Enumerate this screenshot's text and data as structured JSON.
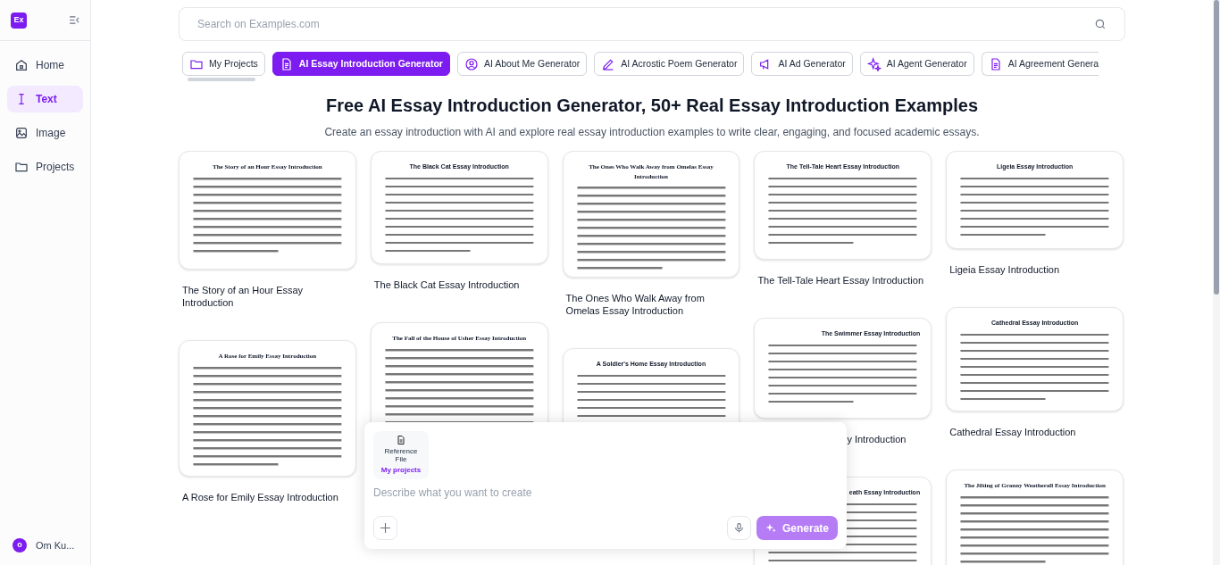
{
  "sidebar": {
    "logo": "Ex",
    "items": [
      {
        "label": "Home",
        "selected": false
      },
      {
        "label": "Text",
        "selected": true
      },
      {
        "label": "Image",
        "selected": false
      },
      {
        "label": "Projects",
        "selected": false
      }
    ],
    "user": {
      "initial": "o",
      "name": "Om Ku..."
    }
  },
  "search": {
    "placeholder": "Search on Examples.com"
  },
  "tabs": [
    {
      "label": "My Projects",
      "selected": false
    },
    {
      "label": "AI Essay Introduction Generator",
      "selected": true
    },
    {
      "label": "AI About Me Generator",
      "selected": false
    },
    {
      "label": "AI Acrostic Poem Generator",
      "selected": false
    },
    {
      "label": "AI Ad Generator",
      "selected": false
    },
    {
      "label": "AI Agent Generator",
      "selected": false
    },
    {
      "label": "AI Agreement Genera",
      "selected": false
    }
  ],
  "heading": "Free AI Essay Introduction Generator, 50+ Real Essay Introduction Examples",
  "subheading": "Create an essay introduction with AI and explore real essay introduction examples to write clear, engaging, and focused academic essays.",
  "columns": [
    {
      "cards": [
        {
          "kind": "serif",
          "doc_title": "The Story of an Hour Essay Introduction",
          "label": "The Story of an Hour Essay Introduction"
        },
        {
          "kind": "serif",
          "doc_title": "A Rose for Emily Essay Introduction",
          "label": "A Rose for Emily Essay Introduction"
        }
      ]
    },
    {
      "cards": [
        {
          "kind": "sans",
          "doc_title": "The Black Cat Essay Introduction",
          "label": "The Black Cat Essay Introduction"
        },
        {
          "kind": "serif",
          "doc_title": "The Fall of the House of Usher Essay Introduction"
        }
      ]
    },
    {
      "cards": [
        {
          "kind": "serif",
          "doc_title": "The Ones Who Walk Away from Omelas Essay Introduction",
          "label": "The Ones Who Walk Away from Omelas Essay Introduction"
        },
        {
          "kind": "sans",
          "doc_title": "A Soldier's Home Essay Introduction"
        }
      ]
    },
    {
      "cards": [
        {
          "kind": "sans",
          "doc_title": "The Tell-Tale Heart Essay Introduction",
          "label": "The Tell-Tale Heart Essay Introduction"
        },
        {
          "kind": "sans",
          "doc_title": "The Swimmer Essay Introduction",
          "label": "y Introduction"
        },
        {
          "kind": "sans",
          "doc_title": "eath Essay Introduction"
        }
      ]
    },
    {
      "cards": [
        {
          "kind": "sans",
          "doc_title": "Ligeia Essay Introduction",
          "label": "Ligeia Essay Introduction"
        },
        {
          "kind": "sans",
          "doc_title": "Cathedral Essay Introduction",
          "label": "Cathedral Essay Introduction"
        },
        {
          "kind": "serif",
          "doc_title": "The Jilting of Granny Weatherall Essay Introduction"
        }
      ]
    }
  ],
  "composer": {
    "attachment": {
      "label": "Reference File",
      "link": "My projects"
    },
    "placeholder": "Describe what you want to create",
    "generate": "Generate"
  }
}
